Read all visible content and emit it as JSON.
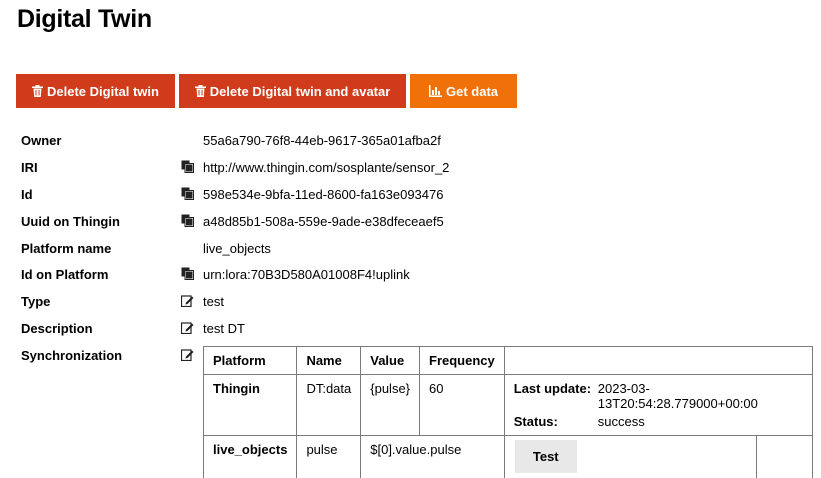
{
  "page": {
    "title": "Digital Twin"
  },
  "buttons": {
    "delete_twin": {
      "label": "Delete Digital twin",
      "icon": "trash-icon",
      "color": "#cf3b1b"
    },
    "delete_twin_avatar": {
      "label": "Delete Digital twin and avatar",
      "icon": "trash-icon",
      "color": "#cf3b1b"
    },
    "get_data": {
      "label": "Get data",
      "icon": "bar-chart-icon",
      "color": "#f0710a"
    }
  },
  "properties": {
    "owner": {
      "label": "Owner",
      "value": "55a6a790-76f8-44eb-9617-365a01afba2f"
    },
    "iri": {
      "label": "IRI",
      "value": "http://www.thingin.com/sosplante/sensor_2",
      "icon": "copy-icon"
    },
    "id": {
      "label": "Id",
      "value": "598e534e-9bfa-11ed-8600-fa163e093476",
      "icon": "copy-icon"
    },
    "uuid": {
      "label": "Uuid on Thingin",
      "value": "a48d85b1-508a-559e-9ade-e38dfeceaef5",
      "icon": "copy-icon"
    },
    "platform_name": {
      "label": "Platform name",
      "value": "live_objects"
    },
    "id_on_platform": {
      "label": "Id on Platform",
      "value": "urn:lora:70B3D580A01008F4!uplink",
      "icon": "copy-icon"
    },
    "type": {
      "label": "Type",
      "value": "test",
      "icon": "edit-icon"
    },
    "description": {
      "label": "Description",
      "value": "test DT",
      "icon": "edit-icon"
    },
    "synchronization": {
      "label": "Synchronization",
      "icon": "edit-icon"
    }
  },
  "sync_table": {
    "headers": [
      "Platform",
      "Name",
      "Value",
      "Frequency"
    ],
    "rows": [
      {
        "platform": "Thingin",
        "name": "DT:data",
        "value": "{pulse}",
        "frequency": "60",
        "last_update_label": "Last update:",
        "last_update": "2023-03-13T20:54:28.779000+00:00",
        "status_label": "Status:",
        "status": "success"
      },
      {
        "platform": "live_objects",
        "name": "pulse",
        "value": "$[0].value.pulse",
        "test_label": "Test"
      }
    ]
  }
}
